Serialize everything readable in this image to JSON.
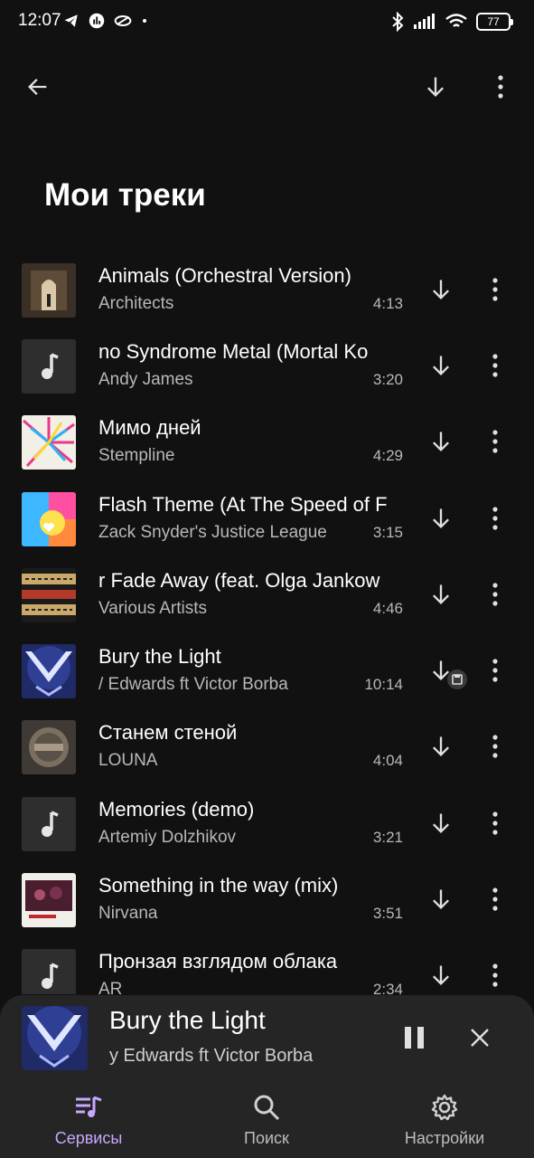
{
  "status_bar": {
    "time": "12:07",
    "battery": "77",
    "icons": [
      "telegram-icon",
      "stats-icon",
      "cloud-icon",
      "dot-icon",
      "bluetooth-icon",
      "signal-icon",
      "wifi-icon",
      "battery-icon"
    ]
  },
  "app_bar": {
    "back_icon": "arrow-left-icon",
    "download_icon": "download-icon",
    "more_icon": "more-vert-icon"
  },
  "page": {
    "title": "Мои треки"
  },
  "tracks": [
    {
      "title": "Animals (Orchestral Version)",
      "artist": "Architects",
      "duration": "4:13",
      "cover": "art-animals"
    },
    {
      "title": "no Syndrome Metal (Mortal Ko",
      "artist": "Andy James",
      "duration": "3:20",
      "cover": "placeholder-note"
    },
    {
      "title": "Мимо дней",
      "artist": "Stempline",
      "duration": "4:29",
      "cover": "art-mimo"
    },
    {
      "title": "Flash Theme (At The Speed of F",
      "artist": "Zack Snyder's Justice League",
      "duration": "3:15",
      "cover": "art-flash"
    },
    {
      "title": "r Fade Away (feat. Olga Jankow",
      "artist": "Various Artists",
      "duration": "4:46",
      "cover": "art-fade"
    },
    {
      "title": "Bury the Light",
      "artist": "/ Edwards ft Victor Borba",
      "duration": "10:14",
      "cover": "art-bury",
      "saved": true
    },
    {
      "title": "Станем стеной",
      "artist": "LOUNA",
      "duration": "4:04",
      "cover": "art-louna"
    },
    {
      "title": "Memories (demo)",
      "artist": "Artemiy Dolzhikov",
      "duration": "3:21",
      "cover": "placeholder-note"
    },
    {
      "title": "Something in the way (mix)",
      "artist": "Nirvana",
      "duration": "3:51",
      "cover": "art-nirvana"
    },
    {
      "title": "Пронзая взглядом облака",
      "artist": "AR",
      "duration": "2:34",
      "cover": "placeholder-note"
    }
  ],
  "mini_player": {
    "title": "Bury the Light",
    "artist": "y Edwards ft Victor Borba",
    "pause_icon": "pause-icon",
    "close_icon": "close-icon"
  },
  "bottom_nav": {
    "services": "Сервисы",
    "search": "Поиск",
    "settings": "Настройки",
    "active": "services"
  },
  "colors": {
    "background": "#111111",
    "mini_player_bg": "#252525",
    "accent": "#c9a6ff",
    "secondary_text": "#b8b8b8"
  }
}
